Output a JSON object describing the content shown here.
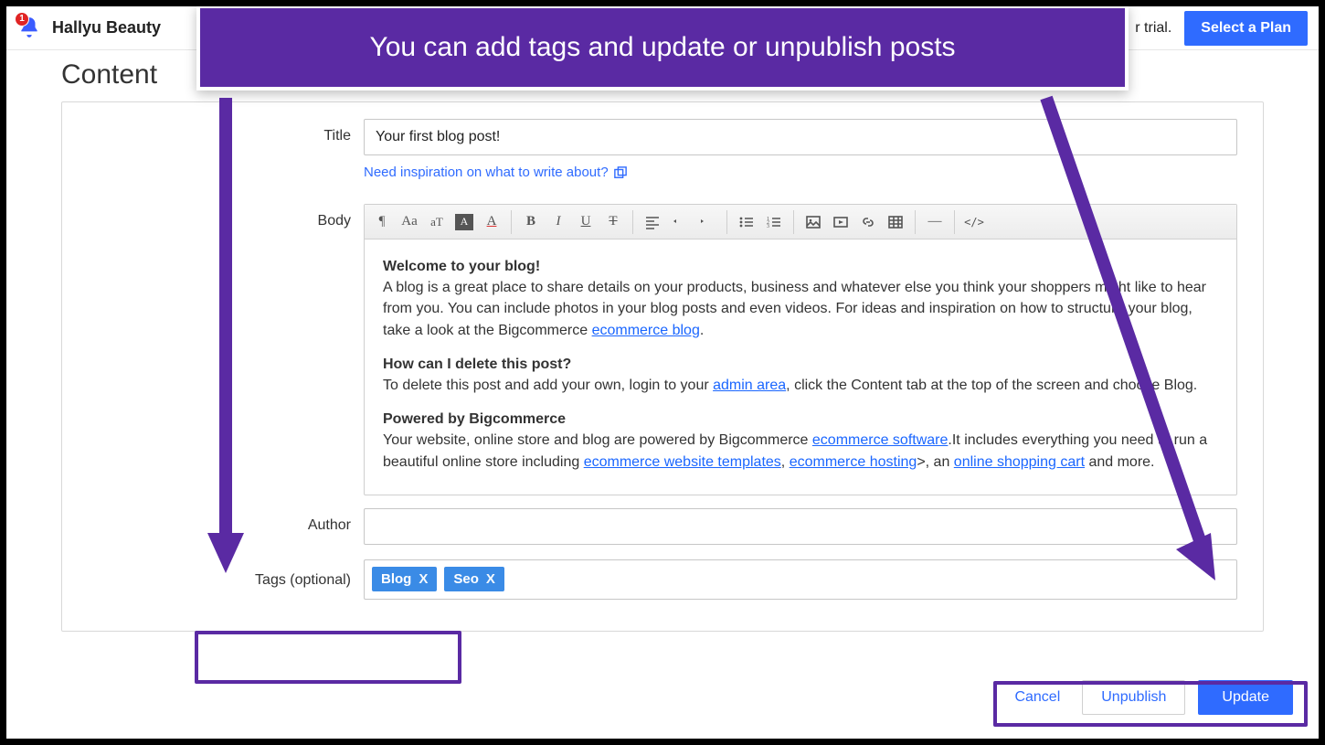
{
  "colors": {
    "accent": "#5a2aa3",
    "primary_btn": "#2f6bff",
    "tag_chip": "#3a8be6",
    "badge": "#e02424"
  },
  "header": {
    "brand": "Hallyu Beauty",
    "notification_count": "1",
    "trial_suffix": "r trial.",
    "select_plan": "Select a Plan"
  },
  "page": {
    "title": "Content"
  },
  "form": {
    "title_label": "Title",
    "title_value": "Your first blog post!",
    "inspiration_link": "Need inspiration on what to write about?",
    "body_label": "Body",
    "author_label": "Author",
    "author_value": "",
    "tags_label": "Tags (optional)",
    "tags": [
      {
        "label": "Blog"
      },
      {
        "label": "Seo"
      }
    ]
  },
  "body_text": {
    "h1": "Welcome to your blog!",
    "p1a": "A blog is a great place to share details on your products, business and whatever else you think your shoppers might like to hear from you. You can include photos in your blog posts and even videos. For ideas and inspiration on how to structure your blog, take a look at the Bigcommerce ",
    "p1_link": "ecommerce blog",
    "p1b": ".",
    "h2": "How can I delete this post?",
    "p2a": "To delete this post and add your own, login to your ",
    "p2_link": "admin area",
    "p2b": ", click the Content tab at the top of the screen and choose Blog.",
    "h3": "Powered by Bigcommerce",
    "p3a": "Your website, online store and blog are powered by Bigcommerce ",
    "p3_link1": "ecommerce software",
    "p3b": ".It includes everything you need to run a beautiful online store including ",
    "p3_link2": "ecommerce website templates",
    "p3c": ", ",
    "p3_link3": "ecommerce hosting",
    "p3d": ">, an ",
    "p3_link4": "online shopping cart",
    "p3e": " and more."
  },
  "toolbar": {
    "paragraph": "¶",
    "font_family": "Aa",
    "font_size": "aT",
    "bg_color": "A",
    "text_color": "A",
    "bold": "B",
    "italic": "I",
    "underline": "U",
    "strike": "T",
    "hr": "—",
    "code": "</>"
  },
  "actions": {
    "cancel": "Cancel",
    "unpublish": "Unpublish",
    "update": "Update"
  },
  "annotation": {
    "callout": "You can add tags and update or unpublish posts"
  }
}
